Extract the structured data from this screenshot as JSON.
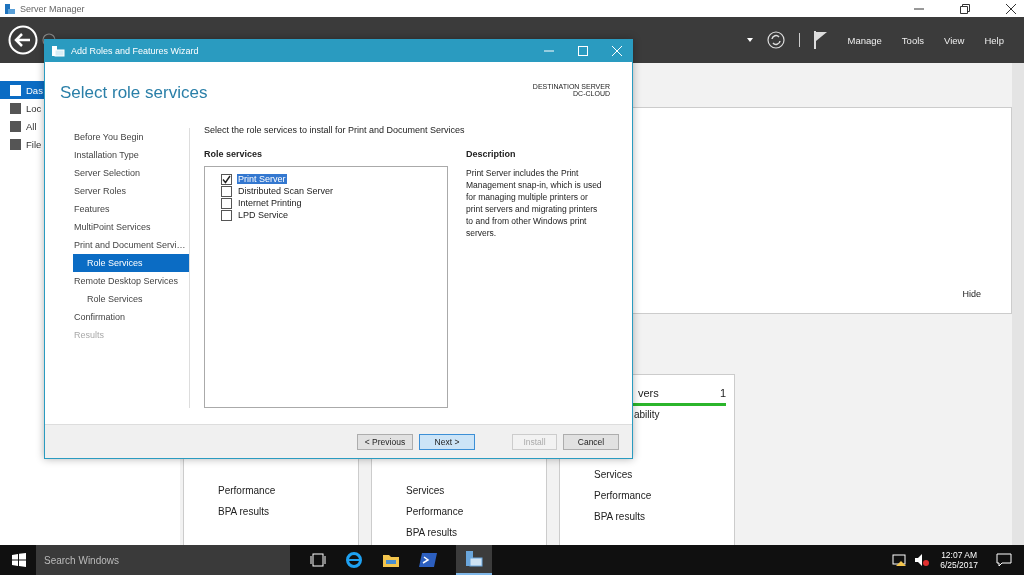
{
  "window": {
    "title": "Server Manager"
  },
  "toolbar": {
    "menus": [
      "Manage",
      "Tools",
      "View",
      "Help"
    ]
  },
  "sidebar": {
    "items": [
      {
        "label": "Das",
        "selected": true
      },
      {
        "label": "Loc",
        "selected": false
      },
      {
        "label": "All",
        "selected": false
      },
      {
        "label": "File",
        "selected": false
      }
    ]
  },
  "welcome": {
    "hide": "Hide"
  },
  "tiles": [
    {
      "items": [
        "Performance",
        "BPA results"
      ]
    },
    {
      "items": [
        "Services",
        "Performance",
        "BPA results"
      ]
    },
    {
      "title": "vers",
      "count": "1",
      "status": "ability",
      "items": [
        "Services",
        "Performance",
        "BPA results"
      ]
    }
  ],
  "dialog": {
    "title": "Add Roles and Features Wizard",
    "heading": "Select role services",
    "destination_label": "DESTINATION SERVER",
    "destination_server": "DC-CLOUD",
    "steps": [
      {
        "label": "Before You Begin",
        "selected": false,
        "disabled": false
      },
      {
        "label": "Installation Type",
        "selected": false,
        "disabled": false
      },
      {
        "label": "Server Selection",
        "selected": false,
        "disabled": false
      },
      {
        "label": "Server Roles",
        "selected": false,
        "disabled": false
      },
      {
        "label": "Features",
        "selected": false,
        "disabled": false
      },
      {
        "label": "MultiPoint Services",
        "selected": false,
        "disabled": false
      },
      {
        "label": "Print and Document Servi…",
        "selected": false,
        "disabled": false,
        "children": [
          {
            "label": "Role Services",
            "selected": true,
            "disabled": false
          }
        ]
      },
      {
        "label": "Remote Desktop Services",
        "selected": false,
        "disabled": false,
        "children": [
          {
            "label": "Role Services",
            "selected": false,
            "disabled": false
          }
        ]
      },
      {
        "label": "Confirmation",
        "selected": false,
        "disabled": false
      },
      {
        "label": "Results",
        "selected": false,
        "disabled": true
      }
    ],
    "instruction": "Select the role services to install for Print and Document Services",
    "role_services_label": "Role services",
    "role_services": [
      {
        "label": "Print Server",
        "checked": true,
        "selected": true
      },
      {
        "label": "Distributed Scan Server",
        "checked": false,
        "selected": false
      },
      {
        "label": "Internet Printing",
        "checked": false,
        "selected": false
      },
      {
        "label": "LPD Service",
        "checked": false,
        "selected": false
      }
    ],
    "description_label": "Description",
    "description": "Print Server includes the Print Management snap-in, which is used for managing multiple printers or print servers and migrating printers to and from other Windows print servers.",
    "buttons": [
      {
        "label": "< Previous",
        "default": false,
        "disabled": false
      },
      {
        "label": "Next >",
        "default": true,
        "disabled": false
      },
      {
        "label": "Install",
        "default": false,
        "disabled": true
      },
      {
        "label": "Cancel",
        "default": false,
        "disabled": false
      }
    ]
  },
  "taskbar": {
    "search_placeholder": "Search Windows",
    "time": "12:07 AM",
    "date": "6/25/2017"
  }
}
